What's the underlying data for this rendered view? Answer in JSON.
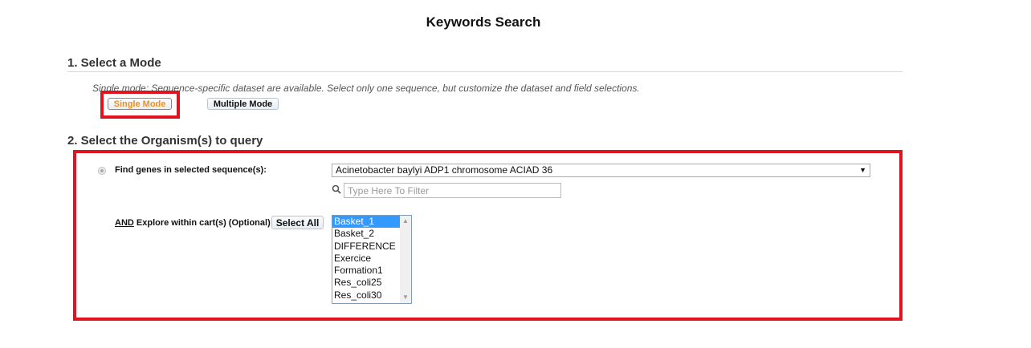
{
  "page": {
    "title": "Keywords Search"
  },
  "section1": {
    "heading": "1. Select a Mode",
    "description": "Single mode: Sequence-specific dataset are available. Select only one sequence, but customize the dataset and field selections.",
    "single_mode_label": "Single Mode",
    "multiple_mode_label": "Multiple Mode"
  },
  "section2": {
    "heading": "2. Select the Organism(s) to query",
    "find_label": "Find genes in selected sequence(s):",
    "sequence_selected": "Acinetobacter baylyi ADP1 chromosome ACIAD 36",
    "filter_placeholder": "Type Here To Filter",
    "and_word": "AND",
    "explore_label": " Explore within cart(s) (Optional) :",
    "select_all_label": "Select All",
    "carts": [
      "Basket_1",
      "Basket_2",
      "DIFFERENCE",
      "Exercice",
      "Formation1",
      "Res_coli25",
      "Res_coli30"
    ],
    "selected_cart": "Basket_1"
  },
  "colors": {
    "highlight": "#e0141e",
    "active_mode": "#f0901e",
    "list_selection": "#3399ff"
  },
  "icons": {
    "filter_icon": "search-icon",
    "dropdown_icon": "dropdown-arrow-icon"
  }
}
